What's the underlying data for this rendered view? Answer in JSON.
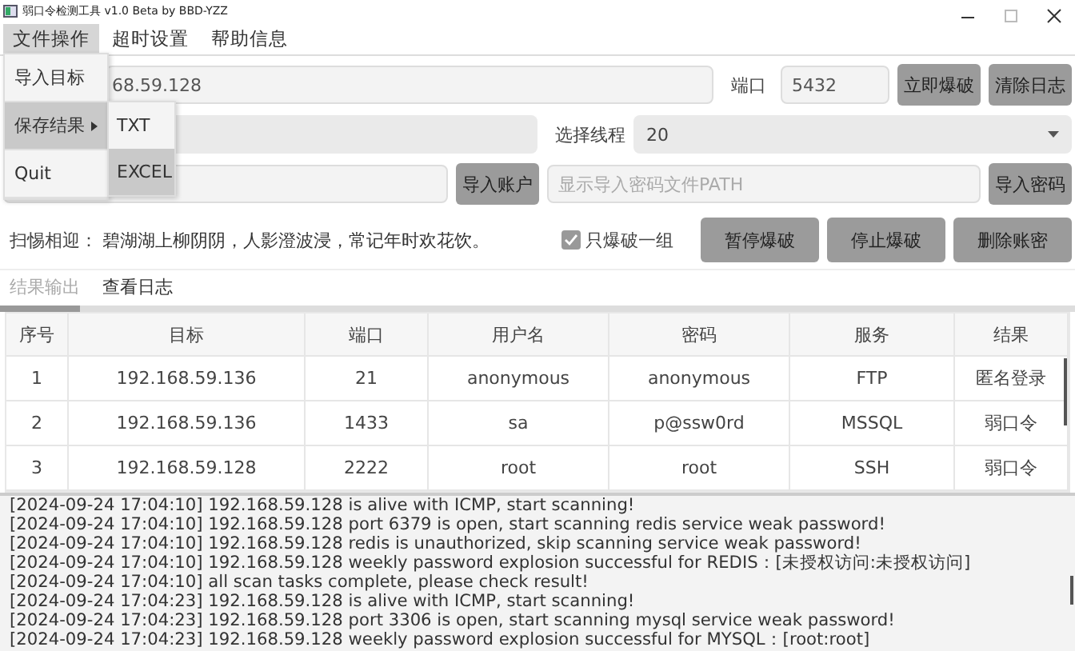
{
  "window": {
    "title": "弱口令检测工具 v1.0 Beta by BBD-YZZ"
  },
  "menu_bar": [
    {
      "label": "文件操作",
      "selected": true
    },
    {
      "label": "超时设置",
      "selected": false
    },
    {
      "label": "帮助信息",
      "selected": false
    }
  ],
  "open_menu": {
    "items": [
      {
        "label": "导入目标",
        "selected": false,
        "has_submenu": false
      },
      {
        "label": "保存结果",
        "selected": true,
        "has_submenu": true
      },
      {
        "label": "Quit",
        "selected": false,
        "has_submenu": false
      }
    ],
    "submenu": [
      {
        "label": "TXT",
        "selected": false
      },
      {
        "label": "EXCEL",
        "selected": true
      }
    ]
  },
  "target": {
    "value": "68.59.128"
  },
  "port": {
    "label": "端口",
    "value": "5432"
  },
  "top_buttons": [
    "立即爆破",
    "清除日志"
  ],
  "thread": {
    "label": "选择线程",
    "value": "20"
  },
  "import_account_button": "导入账户",
  "password_file": {
    "placeholder": "显示导入密码文件PATH"
  },
  "import_password_button": "导入密码",
  "motto": {
    "label": "扫惕相迎：",
    "text": "碧湖湖上柳阴阴，人影澄波浸，常记年时欢花饮。"
  },
  "single_group": {
    "label": "只爆破一组",
    "checked": true
  },
  "action_buttons": [
    "暂停爆破",
    "停止爆破",
    "删除账密"
  ],
  "tabs": [
    {
      "label": "结果输出",
      "selected": true
    },
    {
      "label": "查看日志",
      "selected": false
    }
  ],
  "table": {
    "columns": [
      "序号",
      "目标",
      "端口",
      "用户名",
      "密码",
      "服务",
      "结果"
    ],
    "rows": [
      [
        "1",
        "192.168.59.136",
        "21",
        "anonymous",
        "anonymous",
        "FTP",
        "匿名登录"
      ],
      [
        "2",
        "192.168.59.136",
        "1433",
        "sa",
        "p@ssw0rd",
        "MSSQL",
        "弱口令"
      ],
      [
        "3",
        "192.168.59.128",
        "2222",
        "root",
        "root",
        "SSH",
        "弱口令"
      ]
    ]
  },
  "log": [
    "[2024-09-24 17:04:10] 192.168.59.128 is alive with ICMP, start scanning!",
    "[2024-09-24 17:04:10] 192.168.59.128 port 6379 is open, start scanning redis service weak password!",
    "[2024-09-24 17:04:10] 192.168.59.128 redis is unauthorized, skip scanning service weak password!",
    "[2024-09-24 17:04:10] 192.168.59.128 weekly password explosion successful for REDIS：[未授权访问:未授权访问]",
    "[2024-09-24 17:04:10] all scan tasks complete, please check result!",
    "[2024-09-24 17:04:23] 192.168.59.128 is alive with ICMP, start scanning!",
    "[2024-09-24 17:04:23] 192.168.59.128 port 3306 is open, start scanning mysql service weak password!",
    "[2024-09-24 17:04:23] 192.168.59.128 weekly password explosion successful for MYSQL：[root:root]"
  ]
}
